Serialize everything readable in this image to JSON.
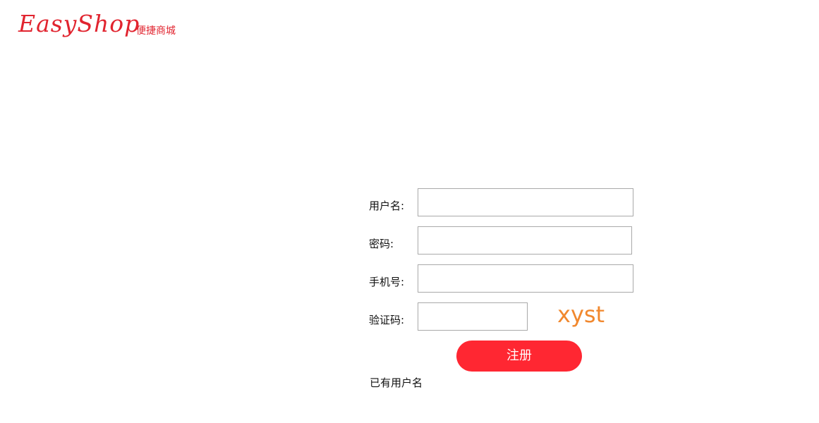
{
  "header": {
    "logo_text": "EasyShop",
    "tagline": "便捷商城"
  },
  "form": {
    "username_label": "用户名:",
    "password_label": "密码:",
    "phone_label": "手机号:",
    "captcha_label": "验证码:",
    "username_value": "",
    "password_value": "",
    "phone_value": "",
    "captcha_value": "",
    "captcha_text": "xyst",
    "register_label": "注册",
    "login_link": "已有用户名"
  },
  "colors": {
    "brand": "#e1242f",
    "button": "#ff2732",
    "captcha": "#f1882e"
  }
}
